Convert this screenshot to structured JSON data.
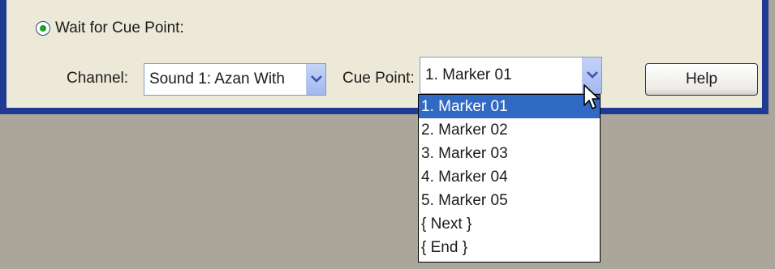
{
  "dialog": {
    "wait_option_label": "Wait for Cue Point:",
    "channel": {
      "label": "Channel:",
      "value": "Sound 1: Azan With"
    },
    "cue_point": {
      "label": "Cue Point:",
      "value": "1. Marker 01",
      "options": [
        "1. Marker 01",
        "2. Marker 02",
        "3. Marker 03",
        "4. Marker 04",
        "5. Marker 05",
        "{ Next }",
        "{ End }"
      ],
      "selected_index": 0
    },
    "help_label": "Help"
  },
  "colors": {
    "dialog_bg": "#ece9d8",
    "frame_border": "#1f3a93",
    "highlight": "#316ac5",
    "desktop_bg": "#aba69a"
  },
  "icons": {
    "radio": "radio-selected-icon",
    "combo_arrow": "chevron-down-icon",
    "cursor": "mouse-pointer-icon"
  }
}
